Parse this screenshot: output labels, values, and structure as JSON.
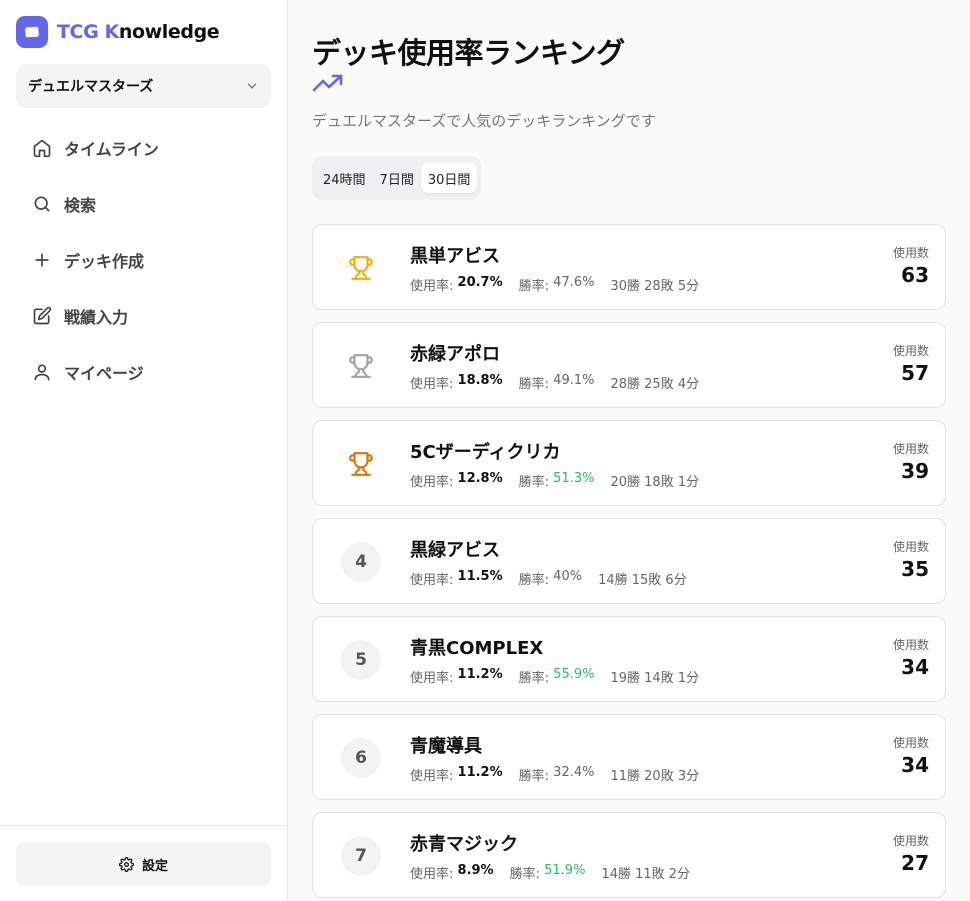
{
  "app": {
    "logo_prefix": "TCG K",
    "logo_suffix": "nowledge",
    "brand_color": "#6366f1"
  },
  "game_select": {
    "value": "デュエルマスターズ"
  },
  "nav": {
    "timeline": "タイムライン",
    "search": "検索",
    "create_deck": "デッキ作成",
    "record_input": "戦績入力",
    "mypage": "マイページ"
  },
  "settings": {
    "label": "設定"
  },
  "page": {
    "title": "デッキ使用率ランキング",
    "subtitle": "デュエルマスターズで人気のデッキランキングです",
    "periods": [
      "24時間",
      "7日間",
      "30日間"
    ],
    "active_period": "30日間"
  },
  "labels": {
    "usage_rate": "使用率:",
    "win_rate": "勝率:",
    "usage_count": "使用数"
  },
  "colors": {
    "gold": "#eab308",
    "silver": "#9ca3af",
    "bronze": "#d97706",
    "win_high": "#22c55e"
  },
  "rankings": [
    {
      "rank": "1",
      "name": "黒単アビス",
      "usage": "20.7%",
      "win": "47.6%",
      "record": "30勝 28敗 5分",
      "count": "63"
    },
    {
      "rank": "2",
      "name": "赤緑アポロ",
      "usage": "18.8%",
      "win": "49.1%",
      "record": "28勝 25敗 4分",
      "count": "57"
    },
    {
      "rank": "3",
      "name": "5Cザーディクリカ",
      "usage": "12.8%",
      "win": "51.3%",
      "record": "20勝 18敗 1分",
      "count": "39"
    },
    {
      "rank": "4",
      "name": "黒緑アビス",
      "usage": "11.5%",
      "win": "40%",
      "record": "14勝 15敗 6分",
      "count": "35"
    },
    {
      "rank": "5",
      "name": "青黒COMPLEX",
      "usage": "11.2%",
      "win": "55.9%",
      "record": "19勝 14敗 1分",
      "count": "34"
    },
    {
      "rank": "6",
      "name": "青魔導具",
      "usage": "11.2%",
      "win": "32.4%",
      "record": "11勝 20敗 3分",
      "count": "34"
    },
    {
      "rank": "7",
      "name": "赤青マジック",
      "usage": "8.9%",
      "win": "51.9%",
      "record": "14勝 11敗 2分",
      "count": "27"
    }
  ]
}
